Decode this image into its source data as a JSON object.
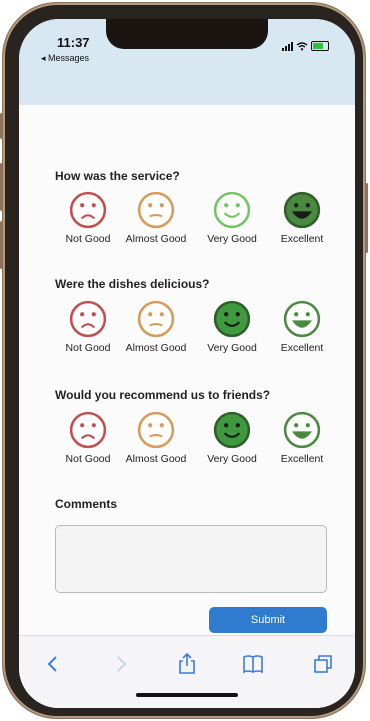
{
  "status": {
    "time": "11:37",
    "back_app": "◂ Messages"
  },
  "questions": [
    {
      "title": "How was the service?",
      "options": [
        {
          "label": "Not Good",
          "mood": "sad",
          "color": "#c0504d",
          "selected": false
        },
        {
          "label": "Almost Good",
          "mood": "neutral",
          "color": "#d79a5a",
          "selected": false
        },
        {
          "label": "Very Good",
          "mood": "happy",
          "color": "#72c465",
          "selected": false
        },
        {
          "label": "Excellent",
          "mood": "excited",
          "color": "#4a8a40",
          "selected": true
        }
      ]
    },
    {
      "title": "Were the dishes delicious?",
      "options": [
        {
          "label": "Not Good",
          "mood": "sad",
          "color": "#c0504d",
          "selected": false
        },
        {
          "label": "Almost Good",
          "mood": "neutral",
          "color": "#d79a5a",
          "selected": false
        },
        {
          "label": "Very Good",
          "mood": "happy",
          "color": "#3f9a3f",
          "selected": true
        },
        {
          "label": "Excellent",
          "mood": "excited",
          "color": "#4a8a40",
          "selected": false
        }
      ]
    },
    {
      "title": "Would you recommend us to friends?",
      "options": [
        {
          "label": "Not Good",
          "mood": "sad",
          "color": "#c0504d",
          "selected": false
        },
        {
          "label": "Almost Good",
          "mood": "neutral",
          "color": "#d79a5a",
          "selected": false
        },
        {
          "label": "Very Good",
          "mood": "happy",
          "color": "#3f9a3f",
          "selected": true
        },
        {
          "label": "Excellent",
          "mood": "excited",
          "color": "#4a8a40",
          "selected": false
        }
      ]
    }
  ],
  "comments": {
    "label": "Comments",
    "value": ""
  },
  "submit_label": "Submit",
  "toolbar": {
    "icons": [
      "back-icon",
      "forward-icon",
      "share-icon",
      "bookmarks-icon",
      "tabs-icon"
    ],
    "accent": "#3d7be0"
  }
}
